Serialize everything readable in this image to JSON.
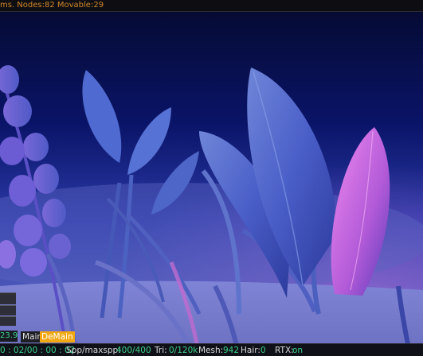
{
  "header": {
    "status_text": "ms. Nodes:82 Movable:29"
  },
  "colors": {
    "status_accent": "#d2872a",
    "value_green": "#39d089",
    "active_tab": "#f3a812"
  },
  "render_view": {
    "scene_icon": "plants-scene-icon"
  },
  "left_panel": {
    "value": "23.90"
  },
  "tabs": [
    {
      "label": "Main",
      "active": false
    },
    {
      "label": "DeMain",
      "active": true
    }
  ],
  "status_bar": {
    "time": "0 : 02/00 : 00 : 02",
    "spp_label": "Spp/maxspp:",
    "spp_value": "400/400",
    "tri_label": "Tri:",
    "tri_value": "0/120k",
    "mesh_label": "Mesh:",
    "mesh_value": "942",
    "hair_label": "Hair:",
    "hair_value": "0",
    "rtx_label": "RTX:",
    "rtx_value": "on"
  }
}
